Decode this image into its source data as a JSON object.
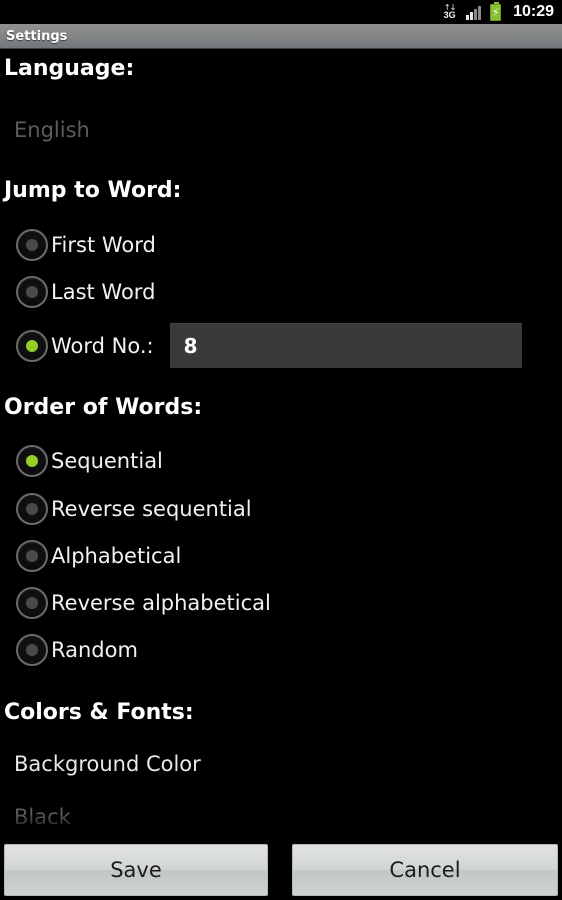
{
  "statusbar": {
    "network_icon": "3g-data-icon",
    "network_label": "3G",
    "network_arrows": "↑↓",
    "signal_icon": "signal-bars-icon",
    "battery_icon": "battery-charging-icon",
    "battery_bolt": "⚡",
    "time": "10:29"
  },
  "titlebar": {
    "title": "Settings"
  },
  "sections": {
    "language": {
      "header": "Language:",
      "selected_value": "English"
    },
    "jump_to_word": {
      "header": "Jump to Word:",
      "options": [
        {
          "label": "First Word",
          "checked": false
        },
        {
          "label": "Last Word",
          "checked": false
        },
        {
          "label": "Word No.:",
          "checked": true
        }
      ],
      "word_number_value": "8",
      "word_number_placeholder": ""
    },
    "order_of_words": {
      "header": "Order of Words:",
      "options": [
        {
          "label": "Sequential",
          "checked": true
        },
        {
          "label": "Reverse sequential",
          "checked": false
        },
        {
          "label": "Alphabetical",
          "checked": false
        },
        {
          "label": "Reverse alphabetical",
          "checked": false
        },
        {
          "label": "Random",
          "checked": false
        }
      ]
    },
    "colors_and_fonts": {
      "header": "Colors & Fonts:",
      "background_color_label": "Background Color",
      "background_color_value": "Black"
    }
  },
  "buttons": {
    "save": "Save",
    "cancel": "Cancel"
  },
  "colors": {
    "accent_green": "#96cd2c",
    "screen_background": "#000000",
    "titlebar_gray": "#848786",
    "field_gray": "#3a3a3a",
    "button_gray": "#d2d6d3"
  }
}
